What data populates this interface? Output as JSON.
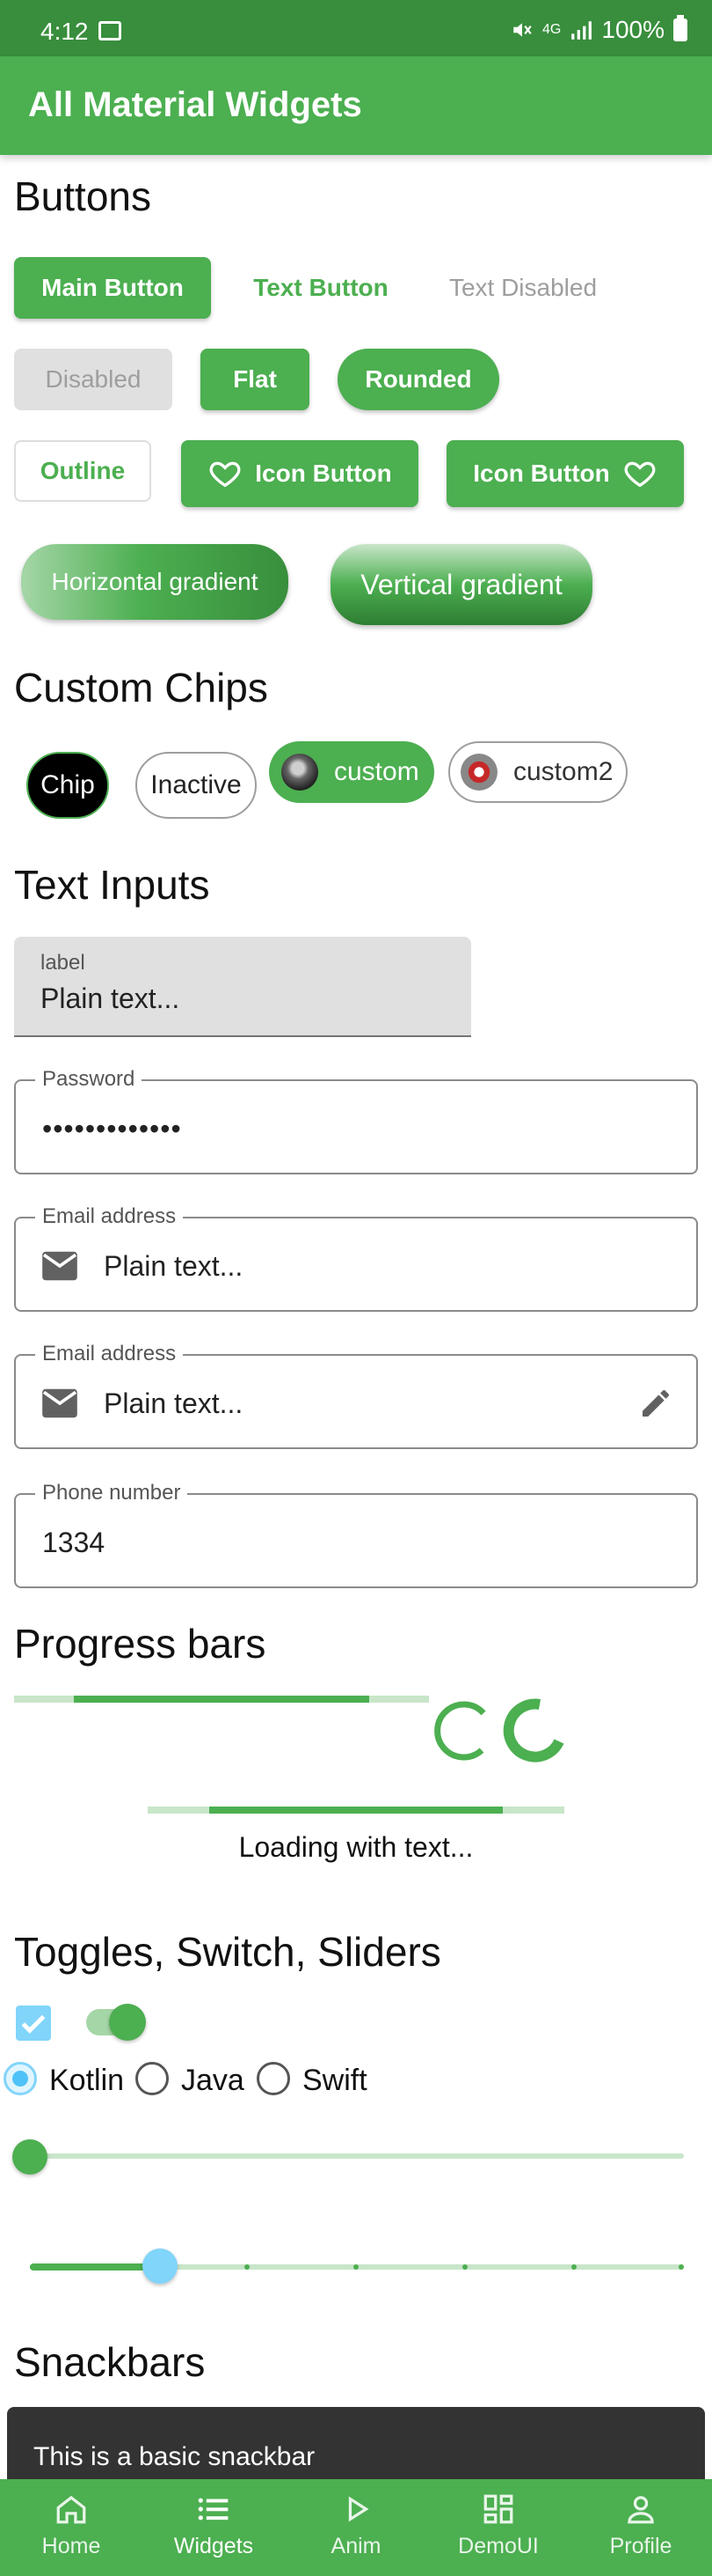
{
  "status_bar": {
    "time": "4:12",
    "network": "4G",
    "battery": "100%"
  },
  "app_bar": {
    "title": "All Material Widgets"
  },
  "buttons": {
    "title": "Buttons",
    "main": "Main Button",
    "text": "Text Button",
    "text_disabled": "Text Disabled",
    "disabled": "Disabled",
    "flat": "Flat",
    "rounded": "Rounded",
    "outline": "Outline",
    "icon_button_leading": "Icon Button",
    "icon_button_trailing": "Icon Button",
    "gradient_horizontal": "Horizontal gradient",
    "gradient_vertical": "Vertical gradient"
  },
  "chips": {
    "title": "Custom Chips",
    "items": [
      "Chip",
      "Inactive",
      "custom",
      "custom2"
    ]
  },
  "inputs": {
    "title": "Text Inputs",
    "plain": {
      "label": "label",
      "value": "Plain text..."
    },
    "password": {
      "label": "Password",
      "value": "•••••••••••••"
    },
    "email1": {
      "label": "Email address",
      "value": "Plain text..."
    },
    "email2": {
      "label": "Email address",
      "value": "Plain text..."
    },
    "phone": {
      "label": "Phone number",
      "value": "1334"
    }
  },
  "progress": {
    "title": "Progress bars",
    "loading_text": "Loading with text..."
  },
  "toggles": {
    "title": "Toggles, Switch, Sliders",
    "checkbox_checked": true,
    "switch_on": true,
    "radio_options": [
      "Kotlin",
      "Java",
      "Swift"
    ],
    "radio_selected": "Kotlin",
    "slider1_value": 0.0,
    "slider2_value": 0.2,
    "slider2_steps": 6
  },
  "snackbars": {
    "title": "Snackbars",
    "basic_text": "This is a basic snackbar"
  },
  "bottom_nav": {
    "items": [
      "Home",
      "Widgets",
      "Anim",
      "DemoUI",
      "Profile"
    ],
    "active": "Widgets"
  },
  "colors": {
    "primary": "#4caf50",
    "primary_dark": "#388e3c",
    "accent": "#81d4fa",
    "snackbar": "#333333"
  }
}
